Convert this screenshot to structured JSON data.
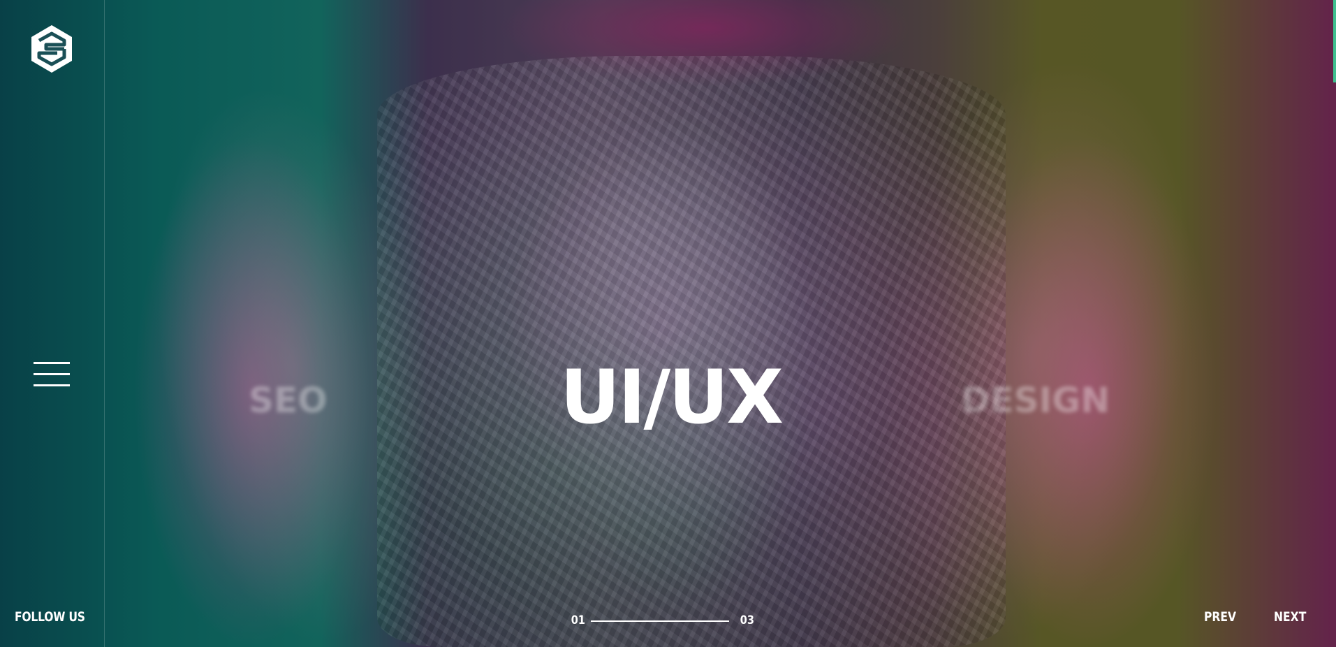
{
  "brand": {
    "logo_icon": "hexagon-s-logo-icon"
  },
  "sidebar": {
    "menu_icon": "hamburger-menu-icon",
    "follow_label": "FOLLOW US"
  },
  "slider": {
    "current_title": "UI/UX",
    "previous_title": "SEO",
    "next_title": "DESIGN",
    "current_index": "01",
    "total_count": "03",
    "progress": 1.0,
    "prev_label": "PREV",
    "next_label": "NEXT"
  },
  "colors": {
    "text": "#ffffff",
    "accent": "#3fbf8f"
  }
}
